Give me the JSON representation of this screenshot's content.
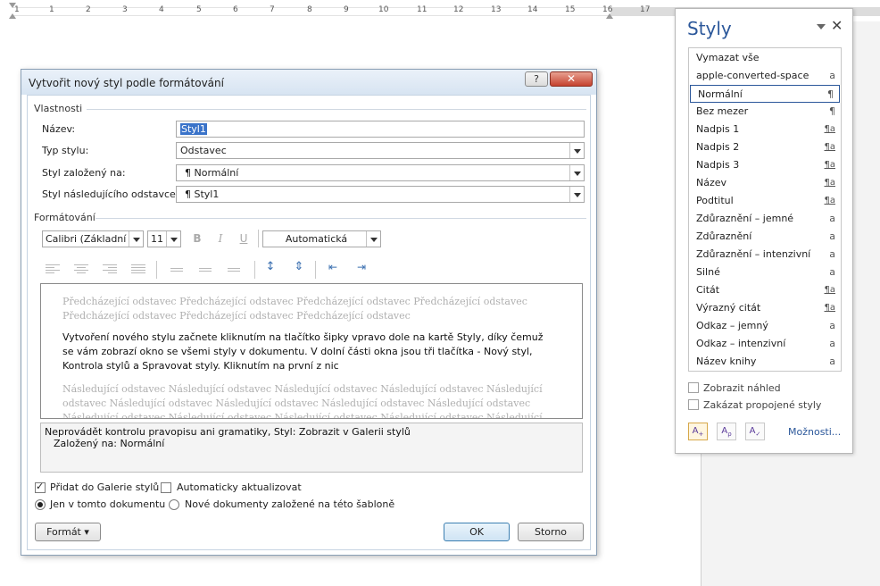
{
  "ruler": {
    "numbers": [
      "1",
      "1",
      "2",
      "3",
      "4",
      "5",
      "6",
      "7",
      "8",
      "9",
      "10",
      "11",
      "12",
      "13",
      "14",
      "15",
      "16",
      "17"
    ]
  },
  "dialog": {
    "title": "Vytvořit nový styl podle formátování",
    "help": "?",
    "close": "✕",
    "properties": {
      "section": "Vlastnosti",
      "name_label": "Název:",
      "name_value": "Styl1",
      "type_label": "Typ stylu:",
      "type_value": "Odstavec",
      "based_label": "Styl založený na:",
      "based_value": "¶  Normální",
      "next_label": "Styl následujícího odstavce:",
      "next_value": "¶  Styl1"
    },
    "formatting": {
      "section": "Formátování",
      "font": "Calibri (Základní te",
      "size": "11",
      "bold": "B",
      "italic": "I",
      "underline": "U",
      "color": "Automatická"
    },
    "preview": {
      "previous": "Předcházející odstavec Předcházející odstavec Předcházející odstavec Předcházející odstavec Předcházející odstavec Předcházející odstavec Předcházející odstavec",
      "main": "Vytvoření nového stylu začnete kliknutím na tlačítko šipky vpravo dole na kartě Styly, díky čemuž se vám zobrazí okno se všemi styly v dokumentu. V dolní části okna jsou tři tlačítka - Nový styl, Kontrola stylů a Spravovat styly. Kliknutím na první z nic",
      "following": "Následující odstavec Následující odstavec Následující odstavec Následující odstavec Následující odstavec Následující odstavec Následující odstavec Následující odstavec Následující odstavec Následující odstavec Následující odstavec Následující odstavec Následující odstavec Následující odstavec Následující odstavec"
    },
    "description": {
      "line1": "Neprovádět kontrolu pravopisu ani gramatiky, Styl: Zobrazit v Galerii stylů",
      "line2": "Založený na: Normální"
    },
    "options": {
      "add_gallery": "Přidat do Galerie stylů",
      "auto_update": "Automaticky aktualizovat",
      "only_doc": "Jen v tomto dokumentu",
      "new_docs": "Nové dokumenty založené na této šabloně"
    },
    "buttons": {
      "format": "Formát ▾",
      "ok": "OK",
      "cancel": "Storno"
    }
  },
  "pane": {
    "title": "Styly",
    "close": "✕",
    "styles": [
      {
        "name": "Vymazat vše",
        "mark": ""
      },
      {
        "name": "apple-converted-space",
        "mark": "a"
      },
      {
        "name": "Normální",
        "mark": "¶"
      },
      {
        "name": "Bez mezer",
        "mark": "¶"
      },
      {
        "name": "Nadpis 1",
        "mark": "¶a"
      },
      {
        "name": "Nadpis 2",
        "mark": "¶a"
      },
      {
        "name": "Nadpis 3",
        "mark": "¶a"
      },
      {
        "name": "Název",
        "mark": "¶a"
      },
      {
        "name": "Podtitul",
        "mark": "¶a"
      },
      {
        "name": "Zdůraznění – jemné",
        "mark": "a"
      },
      {
        "name": "Zdůraznění",
        "mark": "a"
      },
      {
        "name": "Zdůraznění – intenzivní",
        "mark": "a"
      },
      {
        "name": "Silné",
        "mark": "a"
      },
      {
        "name": "Citát",
        "mark": "¶a"
      },
      {
        "name": "Výrazný citát",
        "mark": "¶a"
      },
      {
        "name": "Odkaz – jemný",
        "mark": "a"
      },
      {
        "name": "Odkaz – intenzivní",
        "mark": "a"
      },
      {
        "name": "Název knihy",
        "mark": "a"
      }
    ],
    "show_preview": "Zobrazit náhled",
    "disable_linked": "Zakázat propojené styly",
    "options_link": "Možnosti..."
  }
}
